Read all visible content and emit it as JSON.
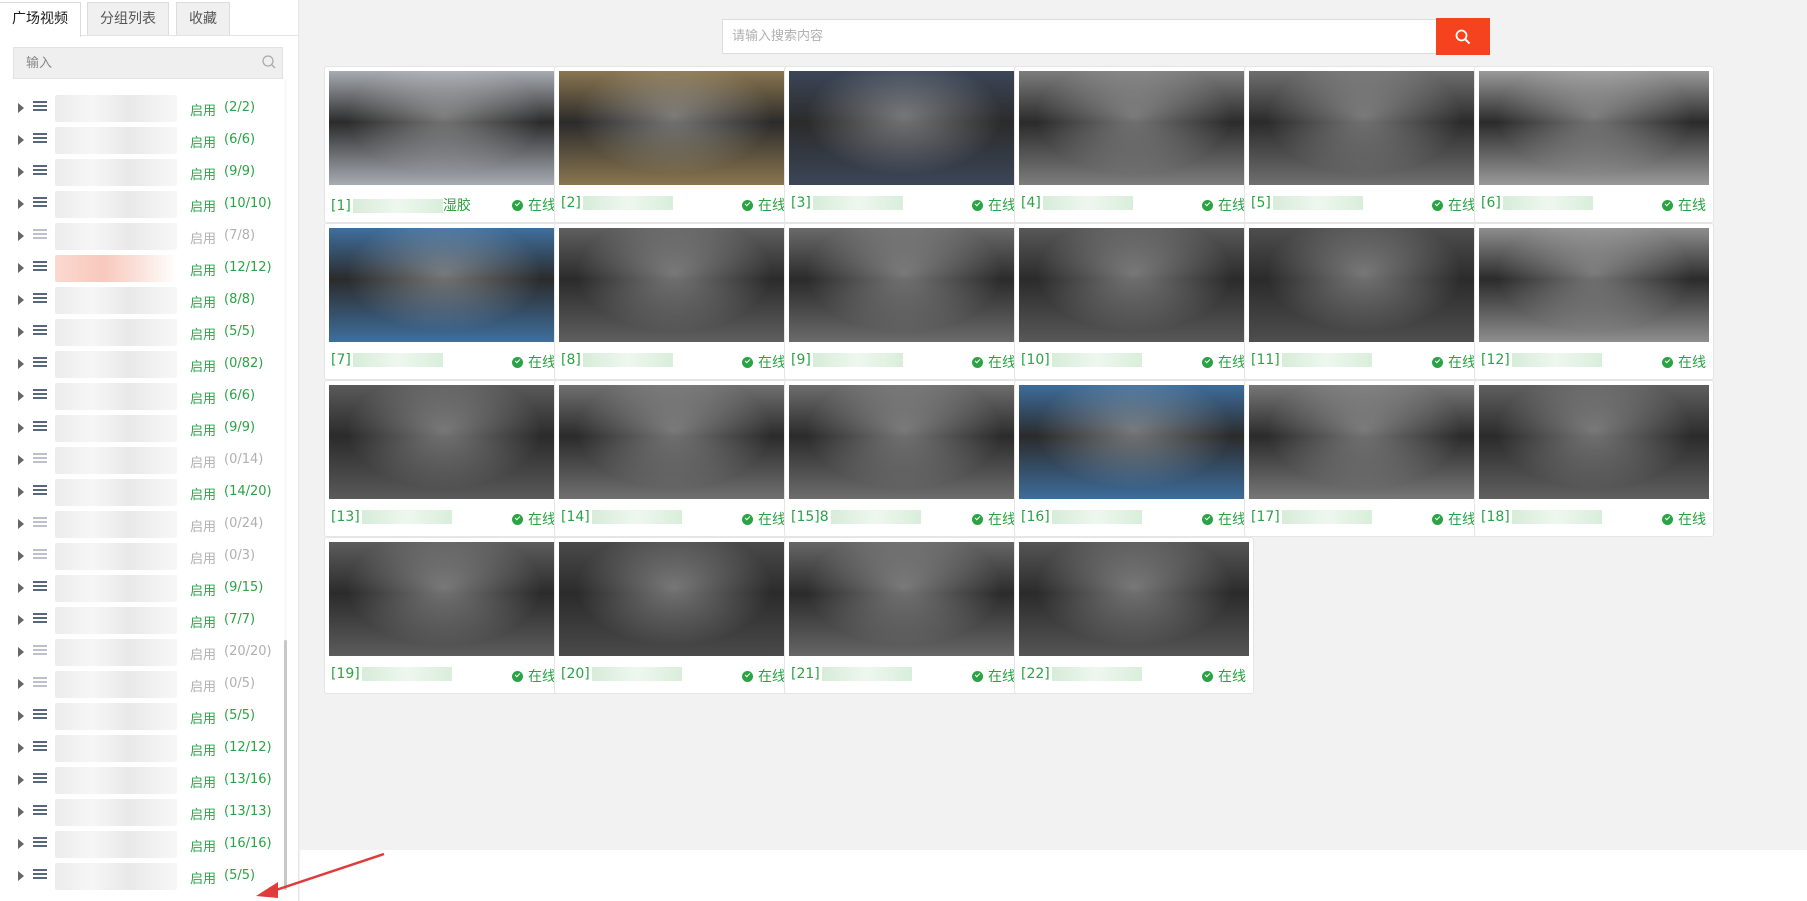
{
  "sidebar": {
    "tabs": [
      {
        "label": "广场视频",
        "active": true
      },
      {
        "label": "分组列表",
        "active": false
      },
      {
        "label": "收藏",
        "active": false
      }
    ],
    "search_placeholder": "输入",
    "rows": [
      {
        "status": "启用",
        "count": "(2/2)",
        "enabled": true
      },
      {
        "status": "启用",
        "count": "(6/6)",
        "enabled": true
      },
      {
        "status": "启用",
        "count": "(9/9)",
        "enabled": true
      },
      {
        "status": "启用",
        "count": "(10/10)",
        "enabled": true
      },
      {
        "status": "启用",
        "count": "(7/8)",
        "enabled": false
      },
      {
        "status": "启用",
        "count": "(12/12)",
        "enabled": true
      },
      {
        "status": "启用",
        "count": "(8/8)",
        "enabled": true
      },
      {
        "status": "启用",
        "count": "(5/5)",
        "enabled": true
      },
      {
        "status": "启用",
        "count": "(0/82)",
        "enabled": true
      },
      {
        "status": "启用",
        "count": "(6/6)",
        "enabled": true
      },
      {
        "status": "启用",
        "count": "(9/9)",
        "enabled": true
      },
      {
        "status": "启用",
        "count": "(0/14)",
        "enabled": false
      },
      {
        "status": "启用",
        "count": "(14/20)",
        "enabled": true
      },
      {
        "status": "启用",
        "count": "(0/24)",
        "enabled": false
      },
      {
        "status": "启用",
        "count": "(0/3)",
        "enabled": false
      },
      {
        "status": "启用",
        "count": "(9/15)",
        "enabled": true
      },
      {
        "status": "启用",
        "count": "(7/7)",
        "enabled": true
      },
      {
        "status": "启用",
        "count": "(20/20)",
        "enabled": false
      },
      {
        "status": "启用",
        "count": "(0/5)",
        "enabled": false
      },
      {
        "status": "启用",
        "count": "(5/5)",
        "enabled": true
      },
      {
        "status": "启用",
        "count": "(12/12)",
        "enabled": true
      },
      {
        "status": "启用",
        "count": "(13/16)",
        "enabled": true
      },
      {
        "status": "启用",
        "count": "(13/13)",
        "enabled": true
      },
      {
        "status": "启用",
        "count": "(16/16)",
        "enabled": true
      },
      {
        "status": "启用",
        "count": "(5/5)",
        "enabled": true
      }
    ]
  },
  "main": {
    "search_placeholder": "请输入搜索内容",
    "online_label": "在线",
    "cameras": [
      {
        "label": "[1]",
        "suffix": "湿胶",
        "tone": "#a8acb3"
      },
      {
        "label": "[2]",
        "suffix": "",
        "tone": "#8a7650"
      },
      {
        "label": "[3]",
        "suffix": "",
        "tone": "#3c4658"
      },
      {
        "label": "[4]",
        "suffix": "",
        "tone": "#7d7d7d"
      },
      {
        "label": "[5]",
        "suffix": "",
        "tone": "#6f6f6f"
      },
      {
        "label": "[6]",
        "suffix": "",
        "tone": "#9a9a9a"
      },
      {
        "label": "[7]",
        "suffix": "",
        "tone": "#3f6f9e"
      },
      {
        "label": "[8]",
        "suffix": "",
        "tone": "#5f5f5f"
      },
      {
        "label": "[9]",
        "suffix": "",
        "tone": "#6a6a6a"
      },
      {
        "label": "[10]",
        "suffix": "",
        "tone": "#585858"
      },
      {
        "label": "[11]",
        "suffix": "",
        "tone": "#4e4e4e"
      },
      {
        "label": "[12]",
        "suffix": "",
        "tone": "#8e8e8e"
      },
      {
        "label": "[13]",
        "suffix": "",
        "tone": "#5a5a5a"
      },
      {
        "label": "[14]",
        "suffix": "",
        "tone": "#707070"
      },
      {
        "label": "[15]8",
        "suffix": "",
        "tone": "#6d6d6d"
      },
      {
        "label": "[16]",
        "suffix": "",
        "tone": "#3d6d9c"
      },
      {
        "label": "[17]",
        "suffix": "",
        "tone": "#777777"
      },
      {
        "label": "[18]",
        "suffix": "",
        "tone": "#606060"
      },
      {
        "label": "[19]",
        "suffix": "",
        "tone": "#5c5c5c"
      },
      {
        "label": "[20]",
        "suffix": "",
        "tone": "#4a4a4a"
      },
      {
        "label": "[21]",
        "suffix": "",
        "tone": "#666666"
      },
      {
        "label": "[22]",
        "suffix": "",
        "tone": "#555555"
      }
    ]
  }
}
